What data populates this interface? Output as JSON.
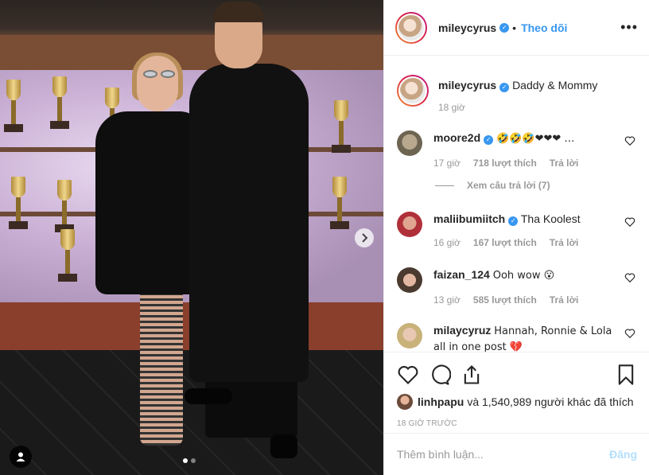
{
  "header": {
    "username": "mileycyrus",
    "separator": "•",
    "follow_label": "Theo dõi",
    "more_label": "•••"
  },
  "caption": {
    "username": "mileycyrus",
    "text": "Daddy & Mommy",
    "time": "18 giờ"
  },
  "comments": [
    {
      "username": "moore2d",
      "verified": true,
      "text": "🤣🤣🤣❤❤❤ …",
      "time": "17 giờ",
      "likes": "718 lượt thích",
      "reply_label": "Trả lời",
      "view_replies": "Xem câu trả lời (7)"
    },
    {
      "username": "maliibumiitch",
      "verified": true,
      "text": "Tha Koolest",
      "time": "16 giờ",
      "likes": "167 lượt thích",
      "reply_label": "Trả lời"
    },
    {
      "username": "faizan_124",
      "verified": false,
      "text": "Ooh wow 😮",
      "time": "13 giờ",
      "likes": "585 lượt thích",
      "reply_label": "Trả lời"
    },
    {
      "username": "milaycyruz",
      "verified": false,
      "text": "Hannah, Ronnie & Lola all in one post 💔"
    }
  ],
  "likes": {
    "user": "linhpapu",
    "rest": "và 1,540,989 người khác đã thích"
  },
  "timestamp": "18 GIỜ TRƯỚC",
  "add_comment": {
    "placeholder": "Thêm bình luận...",
    "post_label": "Đăng"
  },
  "icons": {
    "like": "heart-icon",
    "comment": "comment-icon",
    "share": "share-icon",
    "save": "bookmark-icon",
    "next": "chevron-right-icon",
    "tag": "user-tag-icon"
  },
  "colors": {
    "verified": "#3897f0",
    "follow": "#3897f0",
    "muted": "#999999",
    "post_disabled": "#b2dffc"
  },
  "carousel": {
    "total": 2,
    "active": 1
  }
}
